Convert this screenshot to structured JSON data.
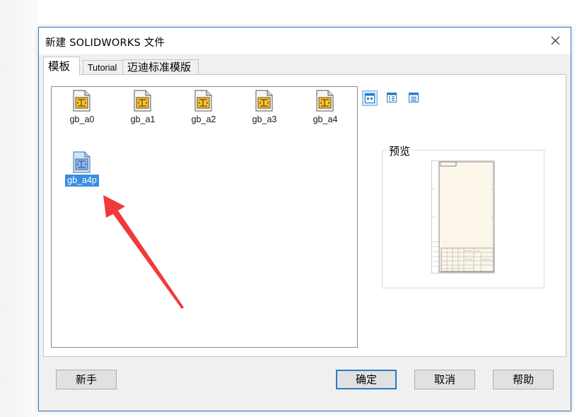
{
  "dialog": {
    "title": "新建 SOLIDWORKS 文件",
    "close_icon": "close-icon"
  },
  "tabs": [
    {
      "label": "模板",
      "active": true
    },
    {
      "label": "Tutorial",
      "active": false
    },
    {
      "label": "迈迪标准模版",
      "active": false
    }
  ],
  "templates": [
    {
      "name": "gb_a0",
      "icon": "drawing-template-icon",
      "selected": false
    },
    {
      "name": "gb_a1",
      "icon": "drawing-template-icon",
      "selected": false
    },
    {
      "name": "gb_a2",
      "icon": "drawing-template-icon",
      "selected": false
    },
    {
      "name": "gb_a3",
      "icon": "drawing-template-icon",
      "selected": false
    },
    {
      "name": "gb_a4",
      "icon": "drawing-template-icon",
      "selected": false
    },
    {
      "name": "gb_a4p",
      "icon": "drawing-template-icon",
      "selected": true
    }
  ],
  "view_modes": [
    {
      "name": "large-icons-view",
      "active": true
    },
    {
      "name": "list-view",
      "active": false
    },
    {
      "name": "details-view",
      "active": false
    }
  ],
  "preview": {
    "label": "预览"
  },
  "buttons": {
    "novice": "新手",
    "ok": "确定",
    "cancel": "取消",
    "help": "帮助"
  },
  "colors": {
    "accent": "#2b79c7",
    "selection": "#3a8fe0",
    "annotation_arrow": "#f03a3a"
  }
}
